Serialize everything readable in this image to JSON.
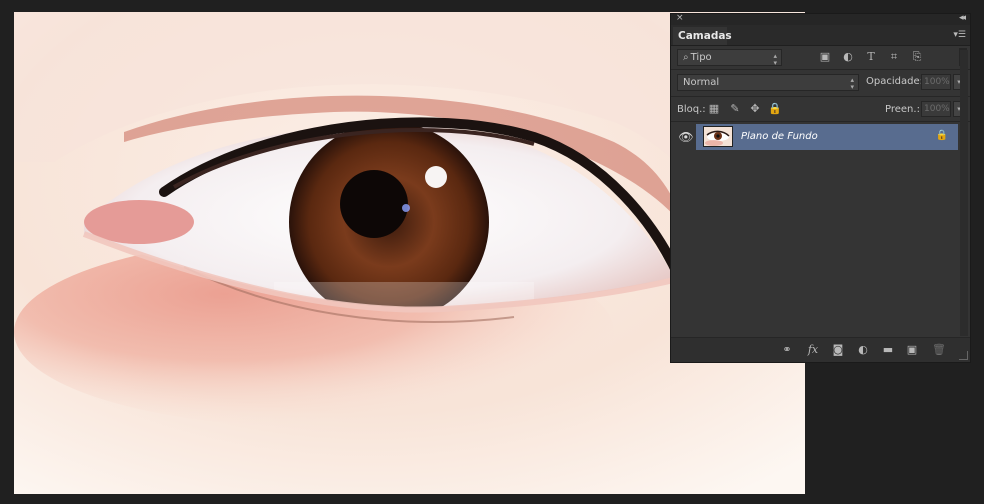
{
  "panel": {
    "close_glyph": "×",
    "collapse_glyph": "◂◂",
    "tab_label": "Camadas",
    "menu_glyph": "▾☰"
  },
  "filter": {
    "search_glyph": "⌕",
    "kind_label": "Tipo",
    "icons": {
      "pixel": "▣",
      "adjustment": "◐",
      "type": "T",
      "shape": "⌗",
      "smart": "⎘"
    }
  },
  "blend": {
    "mode": "Normal",
    "opacity_label": "Opacidade:",
    "opacity_value": "100%"
  },
  "lock": {
    "label": "Bloq.:",
    "icons": {
      "pixels": "▦",
      "brush": "✎",
      "move": "✥",
      "all": "🔒"
    },
    "fill_label": "Preen.:",
    "fill_value": "100%"
  },
  "layers": [
    {
      "name": "Plano de Fundo",
      "visible": true,
      "locked": true,
      "selected": true
    }
  ],
  "glyphs": {
    "eye": "👁",
    "lock": "🔒",
    "arrow_updown": "▴▾",
    "arrow_down": "▾"
  },
  "bottom_bar": {
    "link": "⚭",
    "fx": "fx",
    "mask": "◙",
    "adjustment": "◐",
    "group": "▬",
    "new_layer": "▣",
    "trash": "🗑"
  },
  "colors": {
    "selection": "#586c8f",
    "panel_bg": "#343434"
  }
}
